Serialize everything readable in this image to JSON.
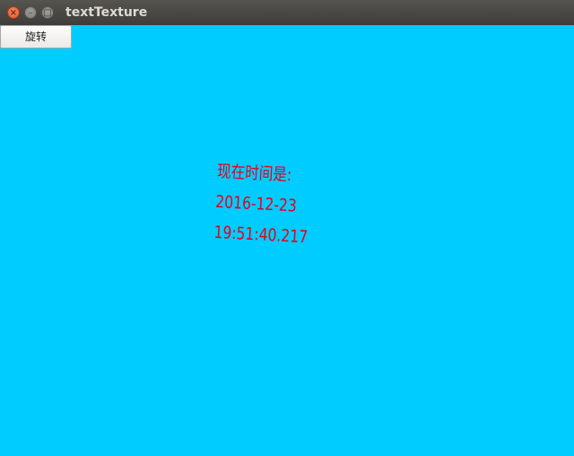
{
  "window": {
    "title": "textTexture",
    "controls": {
      "close_glyph": "×",
      "minimize_glyph": "–",
      "maximize_glyph": "□"
    }
  },
  "toolbar": {
    "rotate_label": "旋转"
  },
  "canvas": {
    "background_color": "#00ccff",
    "text_color": "#e8001c",
    "lines": [
      "现在时间是:",
      "2016-12-23",
      "19:51:40.217"
    ]
  }
}
